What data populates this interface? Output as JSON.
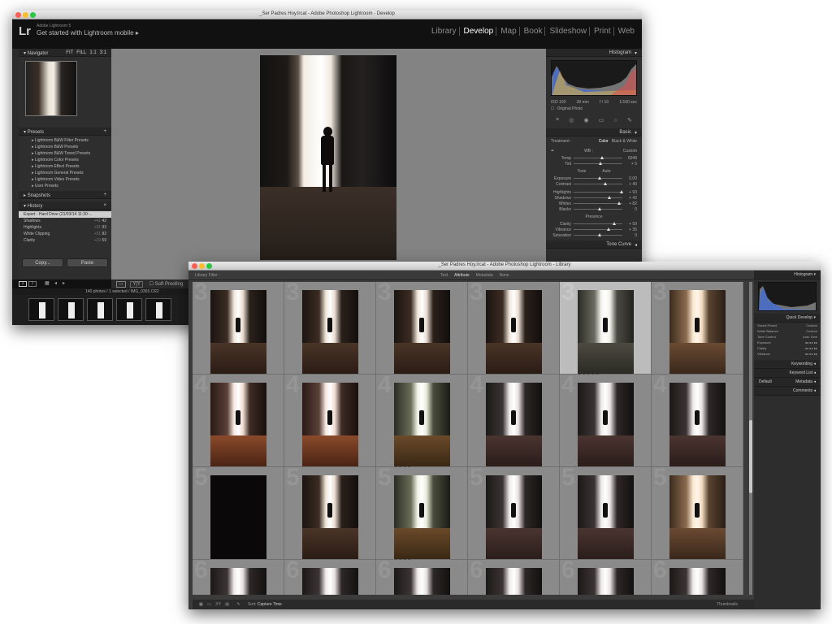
{
  "develop_window": {
    "title": "_Ser Padres Hoy.lrcat - Adobe Photoshop Lightroom - Develop",
    "app_version": "Adobe Lightroom 5",
    "mobile_prompt": "Get started with Lightroom mobile",
    "modules": [
      "Library",
      "Develop",
      "Map",
      "Book",
      "Slideshow",
      "Print",
      "Web"
    ],
    "active_module": "Develop",
    "left_panel": {
      "navigator": {
        "label": "Navigator",
        "buttons": [
          "FIT",
          "FILL",
          "1:1",
          "3:1"
        ]
      },
      "presets": {
        "label": "Presets",
        "items": [
          "Lightroom B&W Filter Presets",
          "Lightroom B&W Presets",
          "Lightroom B&W Toned Presets",
          "Lightroom Color Presets",
          "Lightroom Effect Presets",
          "Lightroom General Presets",
          "Lightroom Video Presets",
          "User Presets"
        ]
      },
      "snapshots": {
        "label": "Snapshots"
      },
      "history": {
        "label": "History",
        "items": [
          {
            "name": "Export - Hard Drive (21/03/14 11:30:...",
            "from": "",
            "to": ""
          },
          {
            "name": "Shadows",
            "from": "+41",
            "to": "42"
          },
          {
            "name": "Highlights",
            "from": "+31",
            "to": "93"
          },
          {
            "name": "White Clipping",
            "from": "+31",
            "to": "82"
          },
          {
            "name": "Clarity",
            "from": "+19",
            "to": "59"
          }
        ]
      },
      "copy_label": "Copy...",
      "paste_label": "Paste"
    },
    "right_panel": {
      "histogram_label": "Histogram",
      "camera_info": [
        "ISO 100",
        "28 mm",
        "f / 10",
        "1/160 sec"
      ],
      "original_photo_label": "Original Photo",
      "basic_label": "Basic",
      "treatment_label": "Treatment :",
      "color_label": "Color",
      "bw_label": "Black & White",
      "wb_label": "WB :",
      "wb_value": "Custom",
      "tone_label": "Tone",
      "auto_label": "Auto",
      "presence_label": "Presence",
      "tone_curve_label": "Tone Curve",
      "sliders": [
        {
          "name": "Temp",
          "value": "6048",
          "pos": 0.55
        },
        {
          "name": "Tint",
          "value": "+ 5",
          "pos": 0.52
        },
        {
          "name": "Exposure",
          "value": "0.00",
          "pos": 0.5
        },
        {
          "name": "Contrast",
          "value": "+ 40",
          "pos": 0.62
        },
        {
          "name": "Highlights",
          "value": "+ 93",
          "pos": 0.95
        },
        {
          "name": "Shadows",
          "value": "+ 42",
          "pos": 0.7
        },
        {
          "name": "Whites",
          "value": "+ 82",
          "pos": 0.9
        },
        {
          "name": "Blacks",
          "value": "0",
          "pos": 0.5
        },
        {
          "name": "Clarity",
          "value": "+ 59",
          "pos": 0.8
        },
        {
          "name": "Vibrance",
          "value": "+ 35",
          "pos": 0.68
        },
        {
          "name": "Saturation",
          "value": "0",
          "pos": 0.5
        }
      ]
    },
    "toolbar": {
      "soft_proofing": "Soft Proofing"
    },
    "filmstrip": {
      "status": "140 photos / 1 selected / IMG_0365.CR2",
      "page_buttons": [
        "1",
        "2"
      ]
    }
  },
  "library_window": {
    "title": "_Ser Padres Hoy.lrcat - Adobe Photoshop Lightroom - Library",
    "filter_bar": {
      "label": "Library Filter :",
      "tabs": [
        "Text",
        "Attribute",
        "Metadata",
        "None"
      ]
    },
    "right_panel": {
      "histogram_label": "Histogram",
      "quick_develop_label": "Quick Develop",
      "saved_preset_label": "Saved Preset",
      "white_balance_label": "White Balance",
      "tone_control_label": "Tone Control",
      "exposure_label": "Exposure",
      "clarity_label": "Clarity",
      "vibrance_label": "Vibrance",
      "preset_value": "Custom",
      "wb_value": "Custom",
      "auto_tone_label": "Auto Tone",
      "keywording_label": "Keywording",
      "keyword_list_label": "Keyword List",
      "metadata_label": "Metadata",
      "default_label": "Default",
      "comments_label": "Comments"
    },
    "bottom_bar": {
      "sort_label": "Sort:",
      "sort_value": "Capture Time",
      "thumbnails_label": "Thumbnails"
    },
    "grid": {
      "rows": [
        {
          "number": "3",
          "cells": [
            {
              "tone": "warm-dark",
              "stars": ""
            },
            {
              "tone": "warm-dark",
              "stars": ""
            },
            {
              "tone": "warm-dark",
              "stars": ""
            },
            {
              "tone": "warm-dark",
              "stars": ""
            },
            {
              "tone": "cool-bright",
              "stars": "★★★★★",
              "selected": true
            },
            {
              "tone": "warm-bright",
              "stars": ""
            }
          ]
        },
        {
          "number": "4",
          "cells": [
            {
              "tone": "red-warm",
              "stars": ""
            },
            {
              "tone": "red-warm",
              "stars": ""
            },
            {
              "tone": "green-bright",
              "stars": "★★★★"
            },
            {
              "tone": "neutral",
              "stars": ""
            },
            {
              "tone": "neutral",
              "stars": ""
            },
            {
              "tone": "neutral",
              "stars": ""
            }
          ]
        },
        {
          "number": "5",
          "cells": [
            {
              "tone": "black",
              "stars": ""
            },
            {
              "tone": "warm-dark",
              "stars": ""
            },
            {
              "tone": "green-bright",
              "stars": "★★★★"
            },
            {
              "tone": "neutral",
              "stars": ""
            },
            {
              "tone": "neutral",
              "stars": ""
            },
            {
              "tone": "warm-bright",
              "stars": ""
            }
          ]
        },
        {
          "number": "6",
          "cells": [
            {
              "tone": "neutral",
              "stars": ""
            },
            {
              "tone": "neutral",
              "stars": ""
            },
            {
              "tone": "neutral",
              "stars": ""
            },
            {
              "tone": "neutral",
              "stars": ""
            },
            {
              "tone": "neutral",
              "stars": ""
            },
            {
              "tone": "neutral",
              "stars": ""
            }
          ]
        }
      ]
    }
  },
  "colors": {
    "panel_bg": "#2e2e2e",
    "canvas_bg": "#838383",
    "grid_bg": "#8c8c8c",
    "accent": "#ffffff"
  }
}
